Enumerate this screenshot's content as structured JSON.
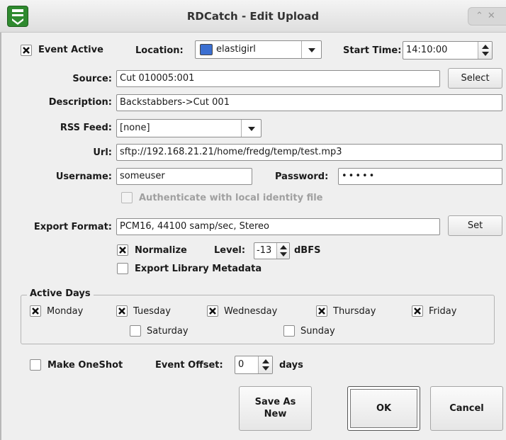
{
  "window": {
    "title": "RDCatch - Edit Upload",
    "app_icon": "rdcatch-logo-icon",
    "controls": [
      "restore-icon",
      "close-icon"
    ]
  },
  "event_active": {
    "label": "Event Active",
    "checked": true
  },
  "location": {
    "label": "Location:",
    "value": "elastigirl",
    "icon": "monitor-icon"
  },
  "start_time": {
    "label": "Start Time:",
    "value": "14:10:00"
  },
  "source": {
    "label": "Source:",
    "value": "Cut 010005:001",
    "button": "Select"
  },
  "description": {
    "label": "Description:",
    "value": "Backstabbers->Cut 001"
  },
  "rss_feed": {
    "label": "RSS Feed:",
    "value": "[none]"
  },
  "url": {
    "label": "Url:",
    "value": "sftp://192.168.21.21/home/fredg/temp/test.mp3"
  },
  "username": {
    "label": "Username:",
    "value": "someuser"
  },
  "password": {
    "label": "Password:",
    "value": "•••••"
  },
  "auth_local": {
    "label": "Authenticate with local identity file",
    "checked": false,
    "enabled": false
  },
  "export_format": {
    "label": "Export Format:",
    "value": "PCM16, 44100 samp/sec, Stereo",
    "button": "Set"
  },
  "normalize": {
    "label": "Normalize",
    "checked": true,
    "level_label": "Level:",
    "level_value": "-13",
    "unit": "dBFS"
  },
  "export_metadata": {
    "label": "Export Library Metadata",
    "checked": false
  },
  "active_days": {
    "title": "Active Days",
    "days": [
      {
        "label": "Monday",
        "checked": true
      },
      {
        "label": "Tuesday",
        "checked": true
      },
      {
        "label": "Wednesday",
        "checked": true
      },
      {
        "label": "Thursday",
        "checked": true
      },
      {
        "label": "Friday",
        "checked": true
      },
      {
        "label": "Saturday",
        "checked": false
      },
      {
        "label": "Sunday",
        "checked": false
      }
    ]
  },
  "one_shot": {
    "label": "Make OneShot",
    "checked": false
  },
  "event_offset": {
    "label": "Event Offset:",
    "value": "0",
    "unit": "days"
  },
  "buttons": {
    "save_as_new_line1": "Save As",
    "save_as_new_line2": "New",
    "ok": "OK",
    "cancel": "Cancel"
  }
}
